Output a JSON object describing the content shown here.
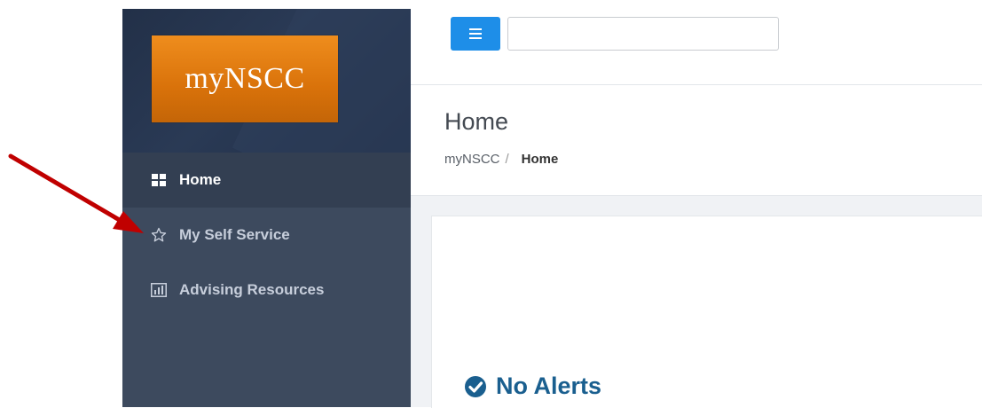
{
  "brand": {
    "logo_text": "myNSCC"
  },
  "sidebar": {
    "items": [
      {
        "label": "Home",
        "icon": "grid-icon",
        "active": true
      },
      {
        "label": "My Self Service",
        "icon": "star-icon",
        "active": false
      },
      {
        "label": "Advising Resources",
        "icon": "bar-chart-icon",
        "active": false
      }
    ]
  },
  "topbar": {
    "search_value": ""
  },
  "page": {
    "title": "Home",
    "breadcrumb": {
      "root": "myNSCC",
      "separator": "/",
      "current": "Home"
    }
  },
  "alerts": {
    "text": "No Alerts"
  },
  "colors": {
    "sidebar_bg": "#3d4a5e",
    "active_item_bg": "#333f52",
    "logo_orange": "#df7a10",
    "menu_button": "#1e8ee8",
    "alert_text": "#1a5f8f",
    "annotation_arrow": "#c00000"
  }
}
